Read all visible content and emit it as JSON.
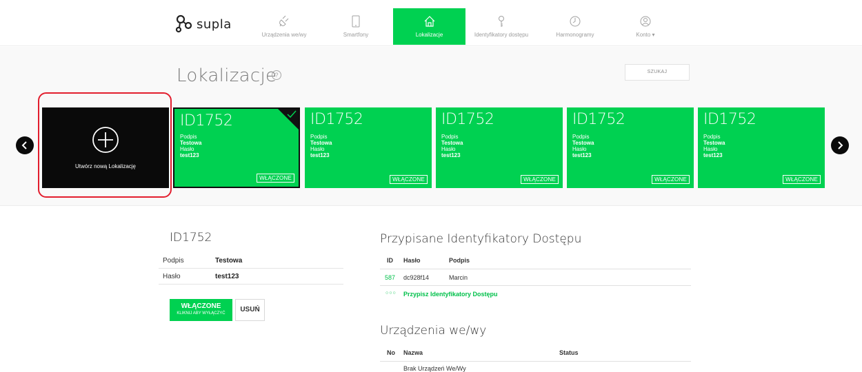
{
  "brand": {
    "name": "supla"
  },
  "nav": {
    "items": [
      {
        "label": "Urządzenia we/wy",
        "icon": "plug-icon"
      },
      {
        "label": "Smartfony",
        "icon": "smartphone-icon"
      },
      {
        "label": "Lokalizacje",
        "icon": "home-icon",
        "active": true
      },
      {
        "label": "Identyfikatory dostępu",
        "icon": "key-icon"
      },
      {
        "label": "Harmonogramy",
        "icon": "clock-icon"
      },
      {
        "label": "Konto ▾",
        "icon": "user-icon"
      }
    ]
  },
  "page": {
    "title": "Lokalizacje",
    "help": "?",
    "search_label": "SZUKAJ"
  },
  "new_card": {
    "label": "Utwórz nową Lokalizację"
  },
  "cards": [
    {
      "id": "ID1752",
      "k1": "Podpis",
      "v1": "Testowa",
      "k2": "Hasło",
      "v2": "test123",
      "badge": "WŁĄCZONE",
      "selected": true
    },
    {
      "id": "ID1752",
      "k1": "Podpis",
      "v1": "Testowa",
      "k2": "Hasło",
      "v2": "test123",
      "badge": "WŁĄCZONE"
    },
    {
      "id": "ID1752",
      "k1": "Podpis",
      "v1": "Testowa",
      "k2": "Hasło",
      "v2": "test123",
      "badge": "WŁĄCZONE"
    },
    {
      "id": "ID1752",
      "k1": "Podpis",
      "v1": "Testowa",
      "k2": "Hasło",
      "v2": "test123",
      "badge": "WŁĄCZONE"
    },
    {
      "id": "ID1752",
      "k1": "Podpis",
      "v1": "Testowa",
      "k2": "Hasło",
      "v2": "test123",
      "badge": "WŁĄCZONE"
    }
  ],
  "detail": {
    "title": "ID1752",
    "rows": [
      {
        "key": "Podpis",
        "value": "Testowa"
      },
      {
        "key": "Hasło",
        "value": "test123"
      }
    ],
    "btn_on_main": "WŁĄCZONE",
    "btn_on_sub": "KLIKNIJ ABY WYŁĄCZYĆ",
    "btn_delete": "USUŃ"
  },
  "access": {
    "title": "Przypisane Identyfikatory Dostępu",
    "headers": [
      "ID",
      "Hasło",
      "Podpis"
    ],
    "rows": [
      {
        "id": "587",
        "pass": "dc928f14",
        "sign": "Marcin"
      }
    ],
    "assign_dots": "○○○",
    "assign_label": "Przypisz Identyfikatory Dostępu"
  },
  "devices": {
    "title": "Urządzenia we/wy",
    "headers": [
      "No",
      "Nazwa",
      "Status"
    ],
    "empty": "Brak Urządzeń We/Wy"
  },
  "colors": {
    "accent": "#00d151",
    "dark": "#0a0a0a",
    "highlight": "#e21d2d"
  }
}
